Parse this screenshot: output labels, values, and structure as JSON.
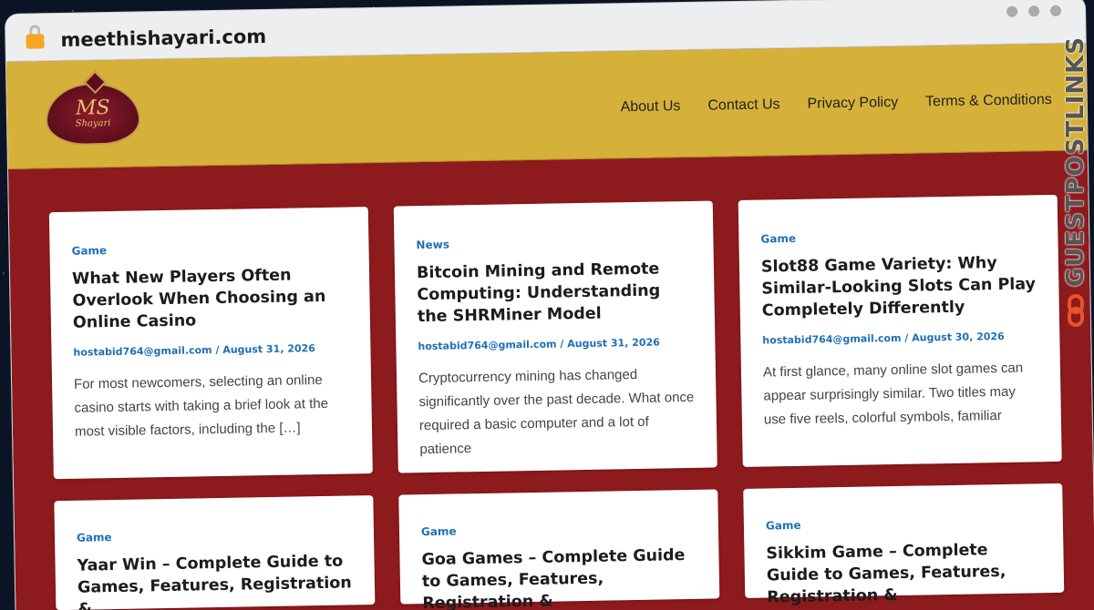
{
  "browser": {
    "url": "meethishayari.com"
  },
  "site": {
    "logo": {
      "monogram": "MS",
      "subtitle": "Shayari"
    },
    "nav": [
      {
        "label": "About Us"
      },
      {
        "label": "Contact Us"
      },
      {
        "label": "Privacy Policy"
      },
      {
        "label": "Terms & Conditions"
      }
    ],
    "posts": [
      {
        "category": "Game",
        "title": "What New Players Often Overlook When Choosing an Online Casino",
        "author": "hostabid764@gmail.com",
        "date": "August 31, 2026",
        "excerpt": "For most newcomers, selecting an online casino starts with taking a brief look at the most visible factors, including the […]"
      },
      {
        "category": "News",
        "title": "Bitcoin Mining and Remote Computing: Understanding the SHRMiner Model",
        "author": "hostabid764@gmail.com",
        "date": "August 31, 2026",
        "excerpt": "Cryptocurrency mining has changed significantly over the past decade. What once required a basic computer and a lot of patience"
      },
      {
        "category": "Game",
        "title": "Slot88 Game Variety: Why Similar-Looking Slots Can Play Completely Differently",
        "author": "hostabid764@gmail.com",
        "date": "August 30, 2026",
        "excerpt": "At first glance, many online slot games can appear surprisingly similar. Two titles may use five reels, colorful symbols, familiar"
      },
      {
        "category": "Game",
        "title": "Yaar Win – Complete Guide to Games, Features, Registration &",
        "author": "",
        "date": "",
        "excerpt": ""
      },
      {
        "category": "Game",
        "title": "Goa Games – Complete Guide to Games, Features, Registration &",
        "author": "",
        "date": "",
        "excerpt": ""
      },
      {
        "category": "Game",
        "title": "Sikkim Game – Complete Guide to Games, Features, Registration &",
        "author": "",
        "date": "",
        "excerpt": ""
      }
    ]
  },
  "watermark": {
    "text": "GUESTPOSTLINKS",
    "icon": "chain-link-icon",
    "color": "#e8542a"
  },
  "colors": {
    "header_bg": "#d6b13a",
    "body_bg": "#8d1a1d",
    "category_link": "#1f6fb5"
  }
}
